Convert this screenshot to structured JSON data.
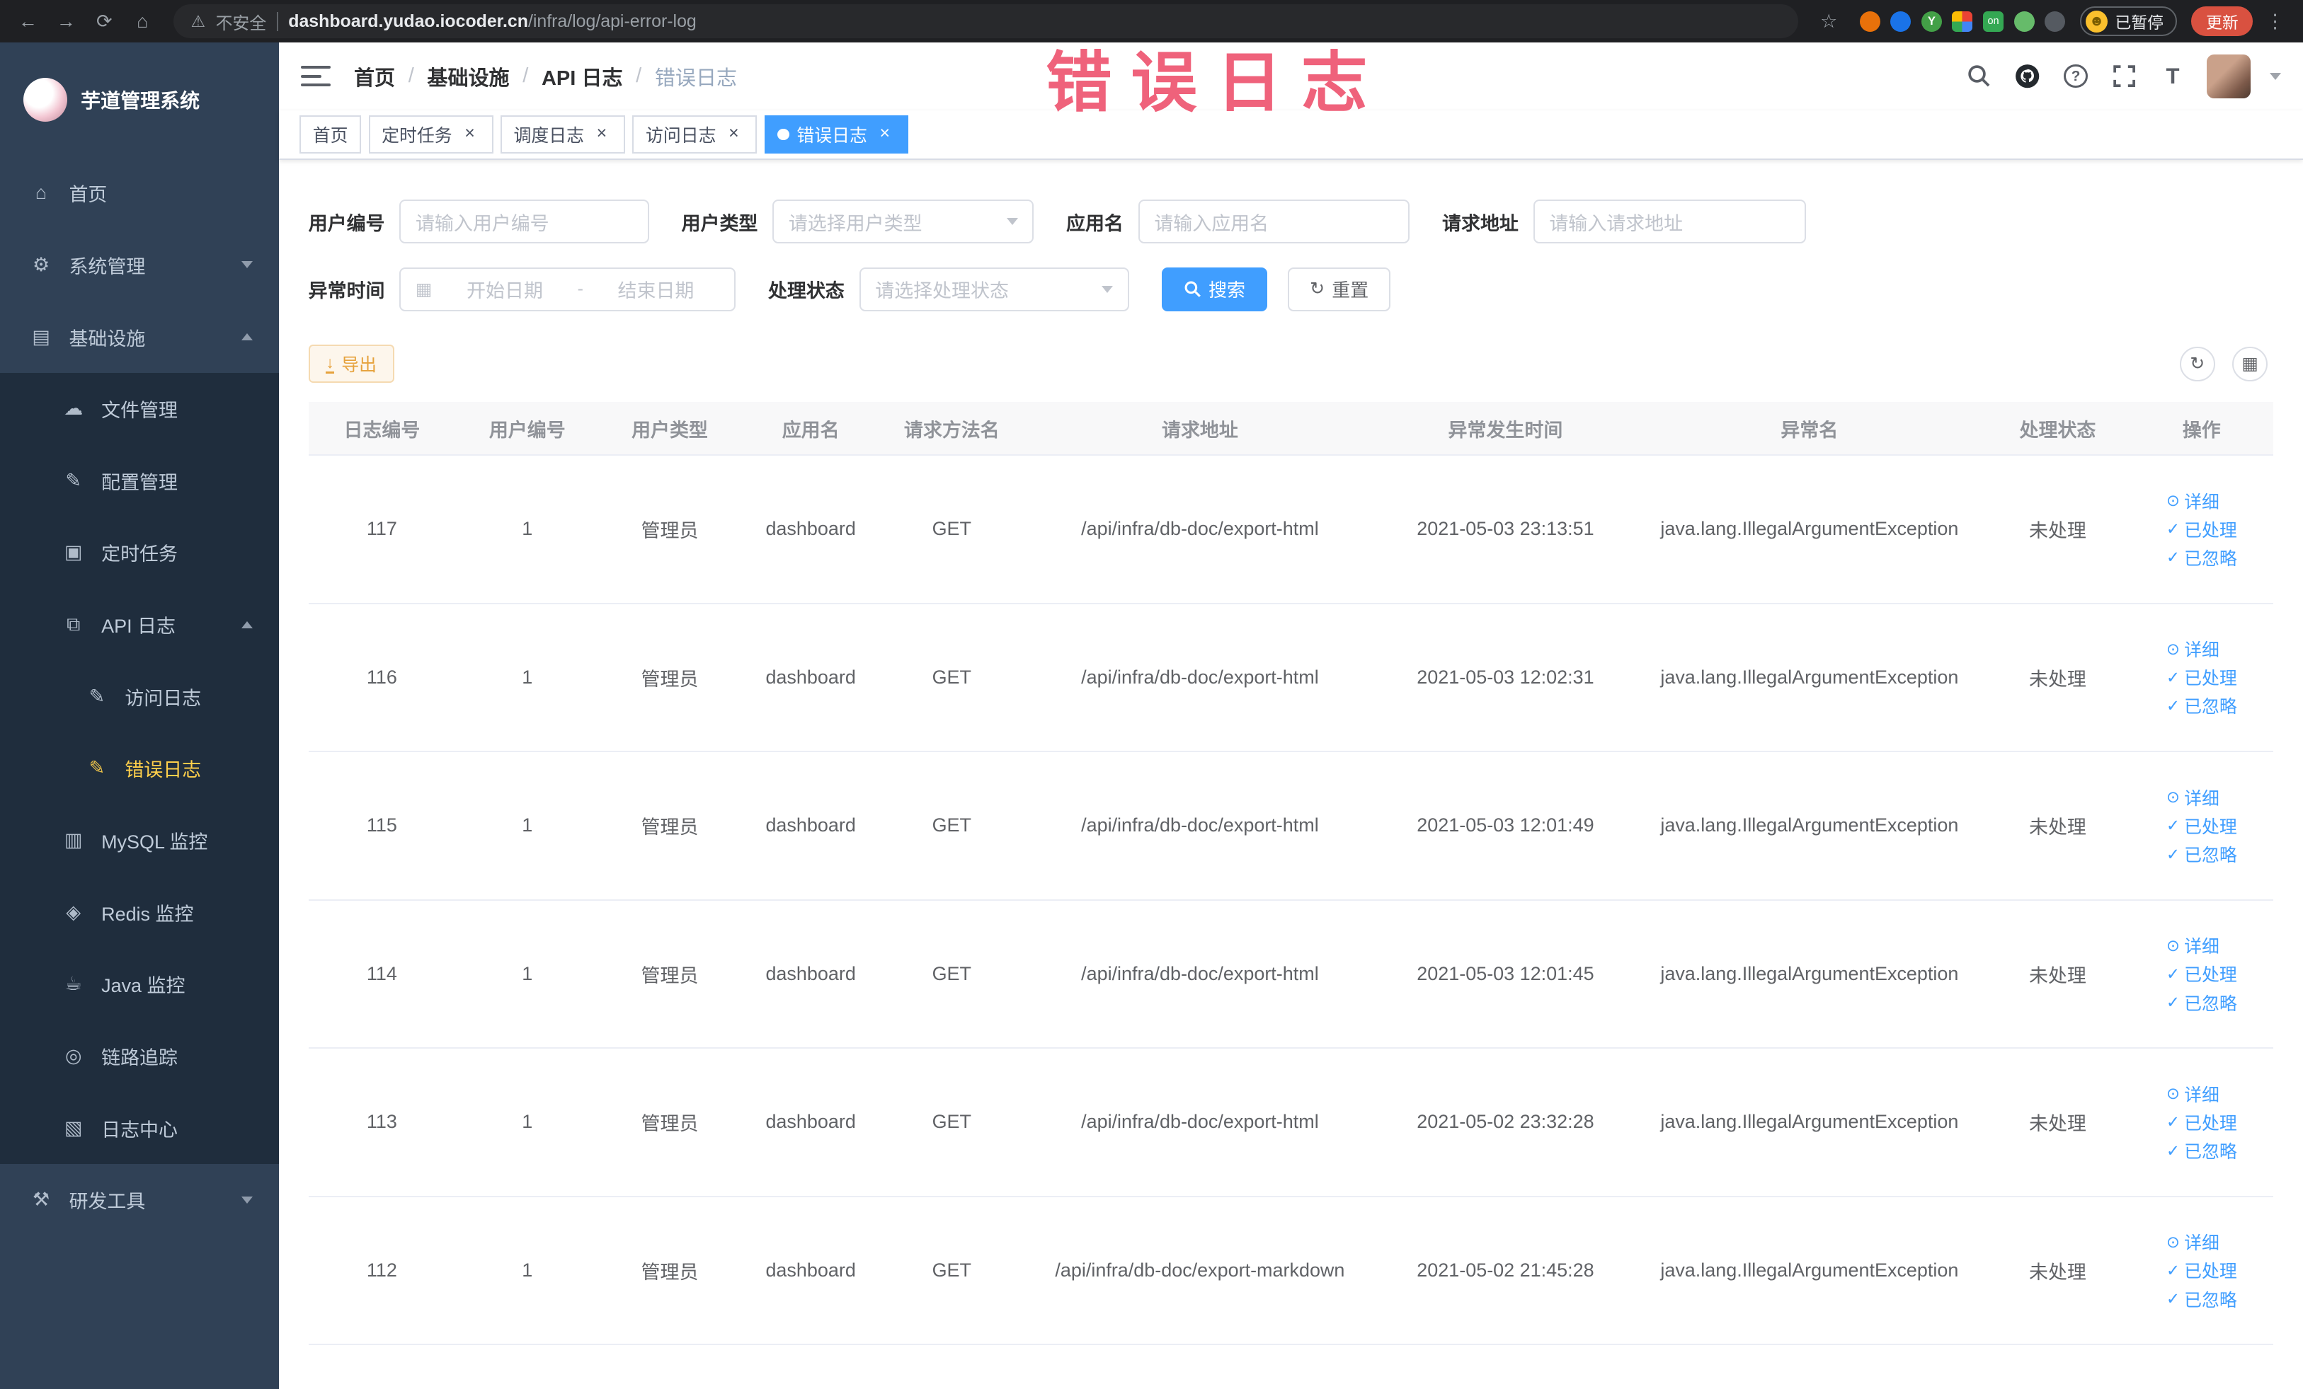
{
  "browser": {
    "security_label": "不安全",
    "url_domain": "dashboard.yudao.iocoder.cn",
    "url_path": "/infra/log/api-error-log",
    "paused_badge": "已暂停",
    "update_button": "更新"
  },
  "watermark": "错误日志",
  "sidebar": {
    "title": "芋道管理系统",
    "items": [
      {
        "label": "首页",
        "icon": "home-icon",
        "level": 1
      },
      {
        "label": "系统管理",
        "icon": "gear-icon",
        "level": 1,
        "expandable": true,
        "expanded": false
      },
      {
        "label": "基础设施",
        "icon": "infrastructure-icon",
        "level": 1,
        "expandable": true,
        "expanded": true
      },
      {
        "label": "文件管理",
        "icon": "file-icon",
        "level": 2,
        "sub": true
      },
      {
        "label": "配置管理",
        "icon": "config-icon",
        "level": 2,
        "sub": true
      },
      {
        "label": "定时任务",
        "icon": "task-icon",
        "level": 2,
        "sub": true
      },
      {
        "label": "API 日志",
        "icon": "api-log-icon",
        "level": 2,
        "sub": true,
        "expandable": true,
        "expanded": true
      },
      {
        "label": "访问日志",
        "icon": "access-log-icon",
        "level": 3,
        "sub": true
      },
      {
        "label": "错误日志",
        "icon": "error-log-icon",
        "level": 3,
        "sub": true,
        "active": true
      },
      {
        "label": "MySQL 监控",
        "icon": "mysql-icon",
        "level": 2,
        "sub": true
      },
      {
        "label": "Redis 监控",
        "icon": "redis-icon",
        "level": 2,
        "sub": true
      },
      {
        "label": "Java 监控",
        "icon": "java-icon",
        "level": 2,
        "sub": true
      },
      {
        "label": "链路追踪",
        "icon": "trace-icon",
        "level": 2,
        "sub": true
      },
      {
        "label": "日志中心",
        "icon": "log-center-icon",
        "level": 2,
        "sub": true
      },
      {
        "label": "研发工具",
        "icon": "tools-icon",
        "level": 1,
        "expandable": true,
        "expanded": false
      }
    ]
  },
  "breadcrumb": [
    "首页",
    "基础设施",
    "API 日志",
    "错误日志"
  ],
  "tabs": [
    {
      "label": "首页",
      "closable": false,
      "active": false
    },
    {
      "label": "定时任务",
      "closable": true,
      "active": false
    },
    {
      "label": "调度日志",
      "closable": true,
      "active": false
    },
    {
      "label": "访问日志",
      "closable": true,
      "active": false
    },
    {
      "label": "错误日志",
      "closable": true,
      "active": true
    }
  ],
  "filters": {
    "user_id_label": "用户编号",
    "user_id_placeholder": "请输入用户编号",
    "user_type_label": "用户类型",
    "user_type_placeholder": "请选择用户类型",
    "app_name_label": "应用名",
    "app_name_placeholder": "请输入应用名",
    "request_url_label": "请求地址",
    "request_url_placeholder": "请输入请求地址",
    "exception_time_label": "异常时间",
    "start_date_placeholder": "开始日期",
    "range_separator": "-",
    "end_date_placeholder": "结束日期",
    "process_status_label": "处理状态",
    "process_status_placeholder": "请选择处理状态",
    "search_button": "搜索",
    "reset_button": "重置"
  },
  "toolbar": {
    "export_button": "导出"
  },
  "table": {
    "columns": [
      "日志编号",
      "用户编号",
      "用户类型",
      "应用名",
      "请求方法名",
      "请求地址",
      "异常发生时间",
      "异常名",
      "处理状态",
      "操作"
    ],
    "actions": [
      "详细",
      "已处理",
      "已忽略"
    ],
    "rows": [
      {
        "log_id": "117",
        "user_id": "1",
        "user_type": "管理员",
        "app_name": "dashboard",
        "method": "GET",
        "url": "/api/infra/db-doc/export-html",
        "time": "2021-05-03 23:13:51",
        "exception": "java.lang.IllegalArgumentException",
        "status": "未处理"
      },
      {
        "log_id": "116",
        "user_id": "1",
        "user_type": "管理员",
        "app_name": "dashboard",
        "method": "GET",
        "url": "/api/infra/db-doc/export-html",
        "time": "2021-05-03 12:02:31",
        "exception": "java.lang.IllegalArgumentException",
        "status": "未处理"
      },
      {
        "log_id": "115",
        "user_id": "1",
        "user_type": "管理员",
        "app_name": "dashboard",
        "method": "GET",
        "url": "/api/infra/db-doc/export-html",
        "time": "2021-05-03 12:01:49",
        "exception": "java.lang.IllegalArgumentException",
        "status": "未处理"
      },
      {
        "log_id": "114",
        "user_id": "1",
        "user_type": "管理员",
        "app_name": "dashboard",
        "method": "GET",
        "url": "/api/infra/db-doc/export-html",
        "time": "2021-05-03 12:01:45",
        "exception": "java.lang.IllegalArgumentException",
        "status": "未处理"
      },
      {
        "log_id": "113",
        "user_id": "1",
        "user_type": "管理员",
        "app_name": "dashboard",
        "method": "GET",
        "url": "/api/infra/db-doc/export-html",
        "time": "2021-05-02 23:32:28",
        "exception": "java.lang.IllegalArgumentException",
        "status": "未处理"
      },
      {
        "log_id": "112",
        "user_id": "1",
        "user_type": "管理员",
        "app_name": "dashboard",
        "method": "GET",
        "url": "/api/infra/db-doc/export-markdown",
        "time": "2021-05-02 21:45:28",
        "exception": "java.lang.IllegalArgumentException",
        "status": "未处理"
      }
    ]
  }
}
